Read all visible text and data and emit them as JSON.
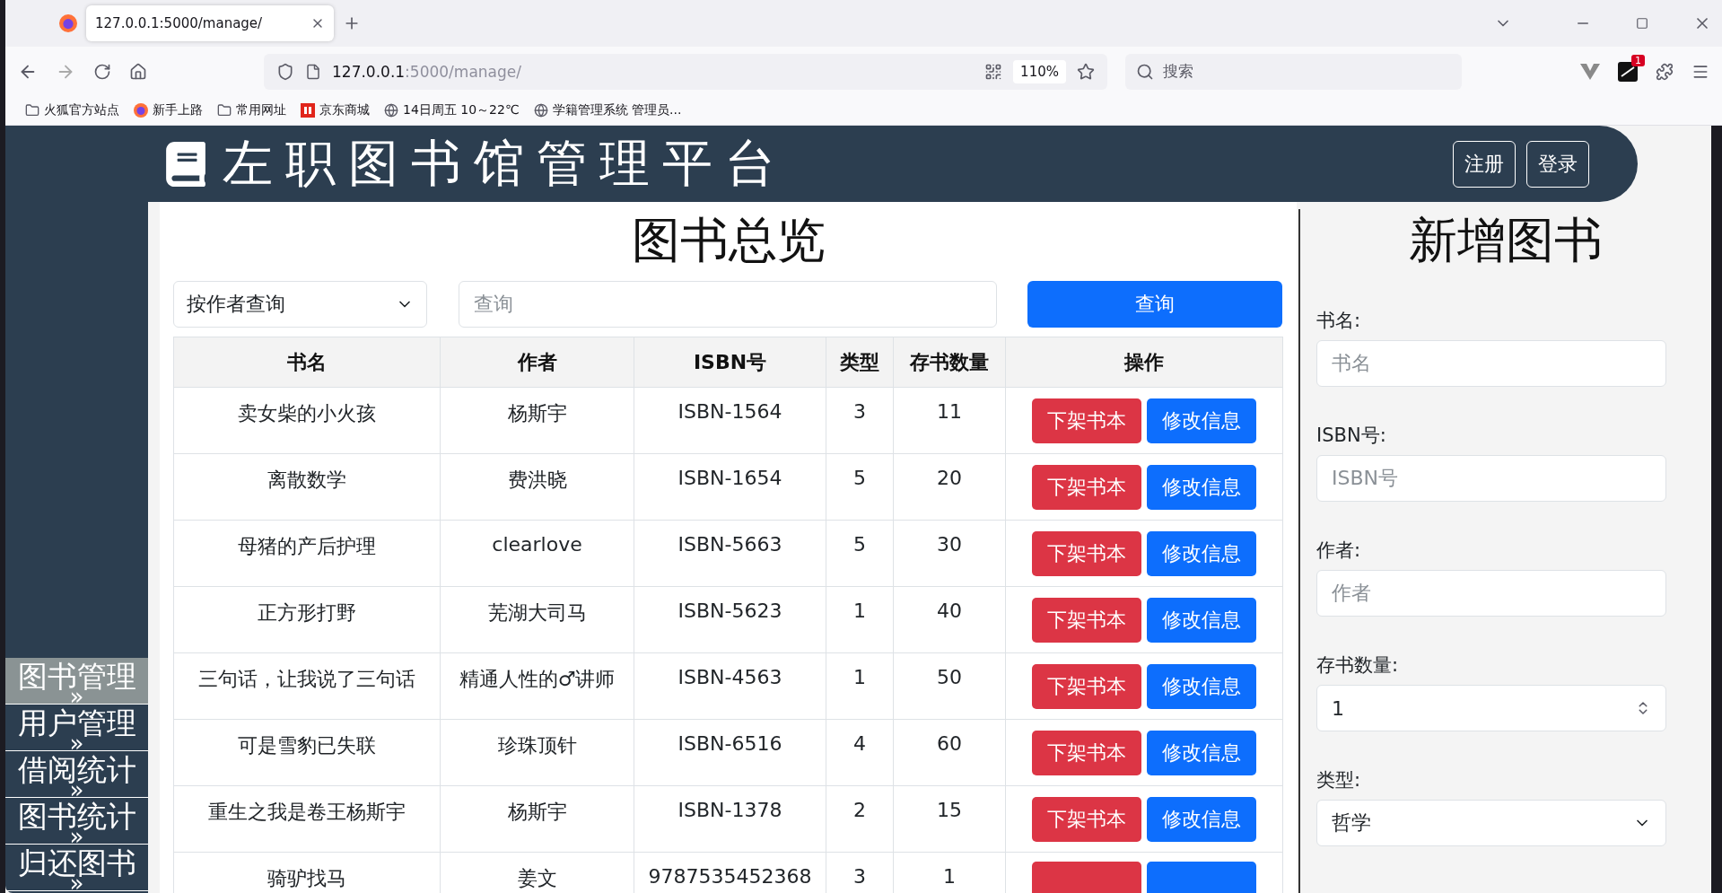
{
  "browser": {
    "tabs": [
      {
        "title": "127.0.0.1:5000/manage/",
        "selected": true
      }
    ],
    "address": {
      "host": "127.0.0.1",
      "rest": ":5000/manage/"
    },
    "zoom": "110%",
    "search_placeholder": "搜索",
    "extension_badge": "1",
    "bookmarks": [
      {
        "label": "火狐官方站点",
        "kind": "folder"
      },
      {
        "label": "新手上路",
        "kind": "firefox"
      },
      {
        "label": "常用网址",
        "kind": "folder"
      },
      {
        "label": "京东商城",
        "kind": "shop"
      },
      {
        "label": "14日周五  10～22℃",
        "kind": "globe"
      },
      {
        "label": "学籍管理系统 管理员...",
        "kind": "globe"
      }
    ]
  },
  "header": {
    "title": "左职图书馆管理平台",
    "buttons": [
      "注册",
      "登录"
    ]
  },
  "sidebar": {
    "items": [
      {
        "label": "图书管理",
        "arrow": "»",
        "selected": true
      },
      {
        "label": "用户管理",
        "arrow": "»",
        "selected": false
      },
      {
        "label": "借阅统计",
        "arrow": "»",
        "selected": false
      },
      {
        "label": "图书统计",
        "arrow": "»",
        "selected": false
      },
      {
        "label": "归还图书",
        "arrow": "»",
        "selected": false
      }
    ]
  },
  "overview": {
    "title": "图书总览",
    "filter": "按作者查询",
    "search_placeholder": "查询",
    "search_button": "查询",
    "table": {
      "columns": [
        "书名",
        "作者",
        "ISBN号",
        "类型",
        "存书数量",
        "操作"
      ],
      "rows": [
        {
          "cells": [
            "卖女柴的小火孩",
            "杨斯宇",
            "ISBN-1564",
            "3",
            "11"
          ],
          "actions": [
            "下架书本",
            "修改信息"
          ]
        },
        {
          "cells": [
            "离散数学",
            "费洪晓",
            "ISBN-1654",
            "5",
            "20"
          ],
          "actions": [
            "下架书本",
            "修改信息"
          ]
        },
        {
          "cells": [
            "母猪的产后护理",
            "clearlove",
            "ISBN-5663",
            "5",
            "30"
          ],
          "actions": [
            "下架书本",
            "修改信息"
          ]
        },
        {
          "cells": [
            "正方形打野",
            "芜湖大司马",
            "ISBN-5623",
            "1",
            "40"
          ],
          "actions": [
            "下架书本",
            "修改信息"
          ]
        },
        {
          "cells": [
            "三句话，让我说了三句话",
            "精通人性的♂讲师",
            "ISBN-4563",
            "1",
            "50"
          ],
          "actions": [
            "下架书本",
            "修改信息"
          ]
        },
        {
          "cells": [
            "可是雪豹已失联",
            "珍珠顶针",
            "ISBN-6516",
            "4",
            "60"
          ],
          "actions": [
            "下架书本",
            "修改信息"
          ]
        },
        {
          "cells": [
            "重生之我是卷王杨斯宇",
            "杨斯宇",
            "ISBN-1378",
            "2",
            "15"
          ],
          "actions": [
            "下架书本",
            "修改信息"
          ]
        },
        {
          "cells": [
            "骑驴找马",
            "姜文",
            "9787535452368",
            "3",
            "1"
          ],
          "actions": [],
          "actions_cut": true
        }
      ]
    }
  },
  "form": {
    "title": "新增图书",
    "fields": [
      {
        "label": "书名:",
        "kind": "text",
        "placeholder": "书名"
      },
      {
        "label": "ISBN号:",
        "kind": "text",
        "placeholder": "ISBN号"
      },
      {
        "label": "作者:",
        "kind": "text",
        "placeholder": "作者"
      },
      {
        "label": "存书数量:",
        "kind": "number",
        "value": "1"
      },
      {
        "label": "类型:",
        "kind": "select",
        "value": "哲学"
      }
    ]
  }
}
